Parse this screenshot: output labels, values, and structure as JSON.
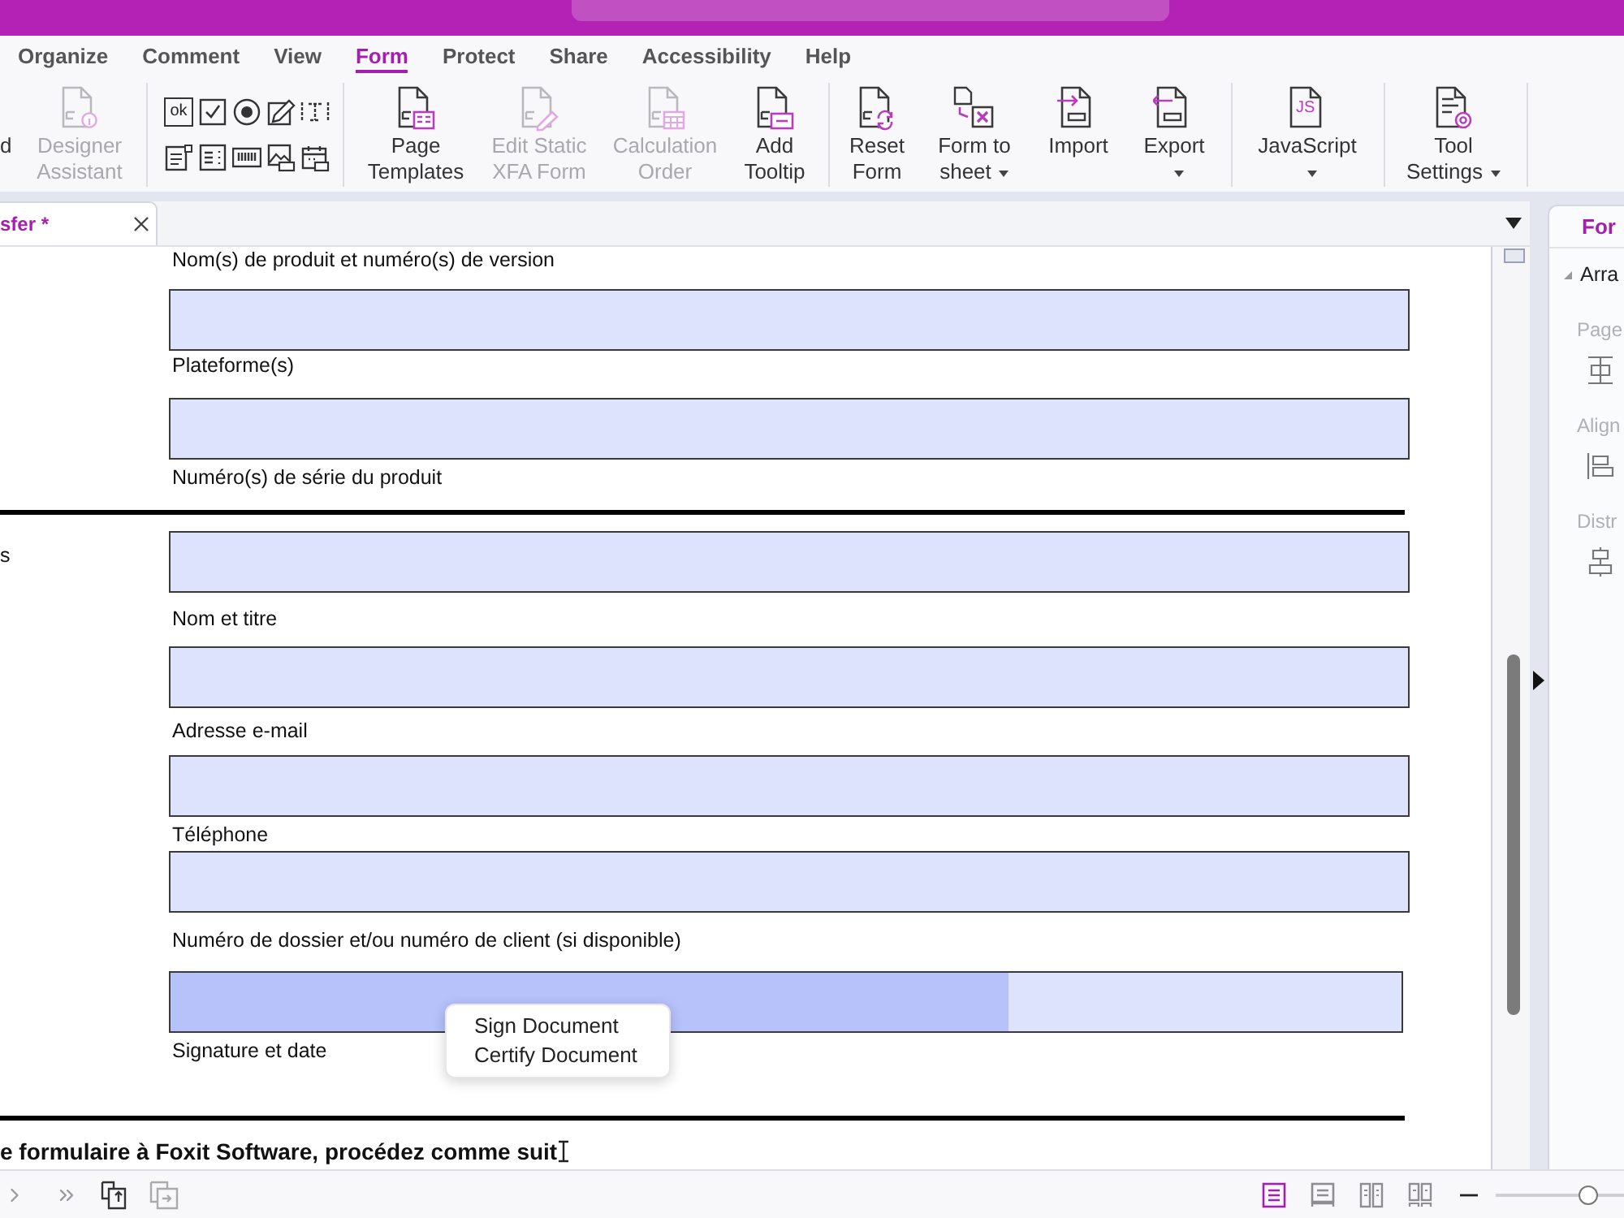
{
  "menu_tabs": [
    {
      "label": "Organize",
      "selected": false
    },
    {
      "label": "Comment",
      "selected": false
    },
    {
      "label": "View",
      "selected": false
    },
    {
      "label": "Form",
      "selected": true
    },
    {
      "label": "Protect",
      "selected": false
    },
    {
      "label": "Share",
      "selected": false
    },
    {
      "label": "Accessibility",
      "selected": false
    },
    {
      "label": "Help",
      "selected": false
    }
  ],
  "ribbon": {
    "groups": [
      {
        "kind": "buttons",
        "buttons": [
          {
            "label": "d",
            "disabled": false,
            "dropdown": false
          },
          {
            "label": "Designer Assistant",
            "disabled": true,
            "dropdown": false
          }
        ]
      },
      {
        "kind": "field_tools",
        "button_tool_text": "ok"
      },
      {
        "kind": "buttons",
        "buttons": [
          {
            "label": "Page Templates",
            "disabled": false,
            "dropdown": false
          },
          {
            "label": "Edit Static XFA Form",
            "disabled": true,
            "dropdown": false
          },
          {
            "label": "Calculation Order",
            "disabled": true,
            "dropdown": false
          },
          {
            "label": "Add Tooltip",
            "disabled": false,
            "dropdown": false
          }
        ]
      },
      {
        "kind": "buttons",
        "buttons": [
          {
            "label": "Reset Form",
            "disabled": false,
            "dropdown": false
          },
          {
            "label": "Form to sheet",
            "disabled": false,
            "dropdown": true
          },
          {
            "label": "Import",
            "disabled": false,
            "dropdown": false
          },
          {
            "label": "Export",
            "disabled": false,
            "dropdown": true
          }
        ]
      },
      {
        "kind": "buttons",
        "buttons": [
          {
            "label": "JavaScript",
            "icon_text": "JS",
            "disabled": false,
            "dropdown": true
          }
        ]
      },
      {
        "kind": "buttons",
        "buttons": [
          {
            "label": "Tool Settings",
            "disabled": false,
            "dropdown": true
          }
        ]
      }
    ]
  },
  "doc_tabs": [
    {
      "title": "sfer *",
      "selected": true
    }
  ],
  "document": {
    "items": [
      {
        "kind": "label",
        "text": "Nom(s) de produit et numéro(s) de version"
      },
      {
        "kind": "field"
      },
      {
        "kind": "label",
        "text": "Plateforme(s)"
      },
      {
        "kind": "field"
      },
      {
        "kind": "label",
        "text": "Numéro(s) de série du produit"
      },
      {
        "kind": "rule"
      },
      {
        "kind": "field",
        "side_label": "s"
      },
      {
        "kind": "label",
        "text": "Nom et titre"
      },
      {
        "kind": "field"
      },
      {
        "kind": "label",
        "text": "Adresse e-mail"
      },
      {
        "kind": "field"
      },
      {
        "kind": "label",
        "text": "Téléphone"
      },
      {
        "kind": "field"
      },
      {
        "kind": "label",
        "text": "Numéro de dossier et/ou numéro de client (si disponible)"
      },
      {
        "kind": "signature_field",
        "hovered": true
      },
      {
        "kind": "label",
        "text": "Signature et date"
      },
      {
        "kind": "rule"
      },
      {
        "kind": "heading",
        "text": "e formulaire à Foxit Software, procédez comme suit"
      }
    ]
  },
  "context_menu": {
    "items": [
      {
        "label": "Sign Document"
      },
      {
        "label": "Certify Document"
      }
    ]
  },
  "right_panel": {
    "tab": {
      "label": "For",
      "selected": true
    },
    "section": {
      "title": "Arra",
      "expanded": true
    },
    "groups": [
      {
        "title": "Page"
      },
      {
        "title": "Align"
      },
      {
        "title": "Distr"
      }
    ]
  },
  "status_bar": {
    "view_modes": [
      {
        "selected": true
      },
      {
        "selected": false
      },
      {
        "selected": false
      },
      {
        "selected": false
      }
    ],
    "zoom": {
      "level": 0.72
    }
  }
}
